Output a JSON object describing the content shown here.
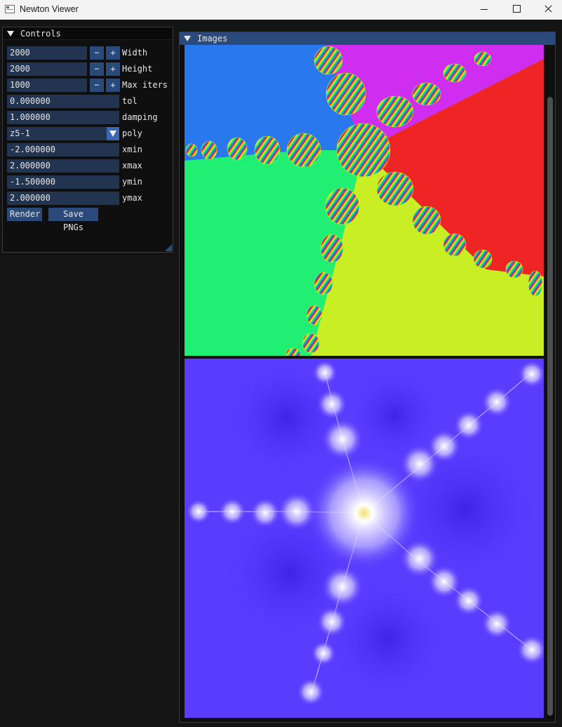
{
  "window": {
    "title": "Newton Viewer",
    "icon": "app-window-icon",
    "buttons": [
      "minimize-icon",
      "maximize-icon",
      "close-icon"
    ]
  },
  "controls": {
    "title": "Controls",
    "width": {
      "value": "2000",
      "label": "Width"
    },
    "height": {
      "value": "2000",
      "label": "Height"
    },
    "max_iters": {
      "value": "1000",
      "label": "Max iters"
    },
    "tol": {
      "value": "0.000000",
      "label": "tol"
    },
    "damping": {
      "value": "1.000000",
      "label": "damping"
    },
    "poly": {
      "value": "z5-1",
      "label": "poly"
    },
    "xmin": {
      "value": "-2.000000",
      "label": "xmin"
    },
    "xmax": {
      "value": "2.000000",
      "label": "xmax"
    },
    "ymin": {
      "value": "-1.500000",
      "label": "ymin"
    },
    "ymax": {
      "value": "2.000000",
      "label": "ymax"
    },
    "minus_label": "−",
    "plus_label": "+",
    "render_label": "Render",
    "save_label": "Save PNGs"
  },
  "images": {
    "title": "Images",
    "basin_colors": [
      "#2a78ee",
      "#cf2ef0",
      "#ef2424",
      "#c9ef24",
      "#21ef73"
    ],
    "iteration_colors": {
      "background": "#5a3cff",
      "glow": "#ffffff",
      "center": "#f2e070"
    }
  }
}
